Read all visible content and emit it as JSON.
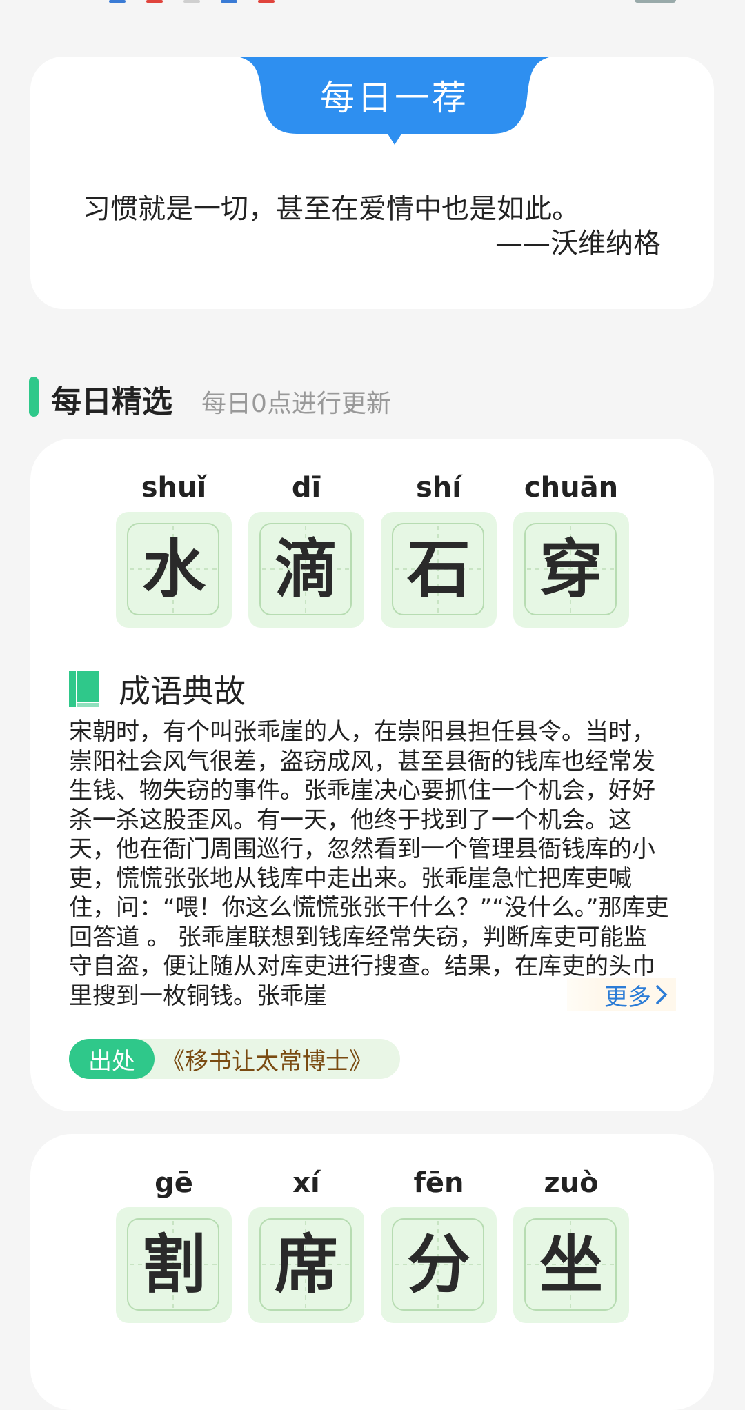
{
  "colors": {
    "accent_blue": "#2e8ff0",
    "accent_green": "#2fc88a",
    "link_blue": "#2b7cd6",
    "source_brown": "#7a4b12",
    "tile_bg": "#e6f7e4"
  },
  "recommend": {
    "banner": "每日一荐",
    "quote": "习惯就是一切，甚至在爱情中也是如此。",
    "author": "——沃维纳格"
  },
  "section": {
    "title": "每日精选",
    "subtitle": "每日0点进行更新"
  },
  "idioms": [
    {
      "chars": [
        {
          "pinyin": "shuǐ",
          "char": "水"
        },
        {
          "pinyin": "dī",
          "char": "滴"
        },
        {
          "pinyin": "shí",
          "char": "石"
        },
        {
          "pinyin": "chuān",
          "char": "穿"
        }
      ],
      "story_title": "成语典故",
      "story": "宋朝时，有个叫张乖崖的人，在崇阳县担任县令。当时，崇阳社会风气很差，盗窃成风，甚至县衙的钱库也经常发生钱、物失窃的事件。张乖崖决心要抓住一个机会，好好杀一杀这股歪风。有一天，他终于找到了一个机会。这天，他在衙门周围巡行，忽然看到一个管理县衙钱库的小吏，慌慌张张地从钱库中走出来。张乖崖急忙把库吏喊住，问：“喂！你这么慌慌张张干什么？”“没什么。”那库吏回答道 。 张乖崖联想到钱库经常失窃，判断库吏可能监守自盗，便让随从对库吏进行搜查。结果，在库吏的头巾里搜到一枚铜钱。张乖崖",
      "more": "更多",
      "source_label": "出处",
      "source": "《移书让太常博士》"
    },
    {
      "chars": [
        {
          "pinyin": "gē",
          "char": "割"
        },
        {
          "pinyin": "xí",
          "char": "席"
        },
        {
          "pinyin": "fēn",
          "char": "分"
        },
        {
          "pinyin": "zuò",
          "char": "坐"
        }
      ]
    }
  ]
}
